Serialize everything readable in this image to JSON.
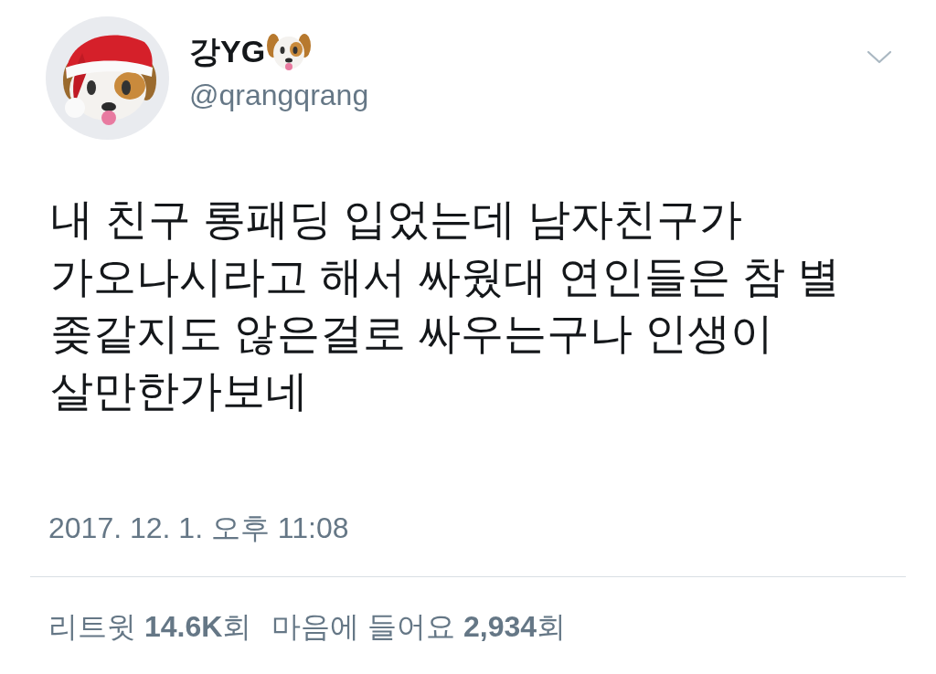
{
  "author": {
    "display_name": "강YG",
    "handle": "@qrangqrang"
  },
  "tweet": {
    "text": "내 친구 롱패딩 입었는데 남자친구가 가오나시라고 해서 싸웠대 연인들은 참 별 좆같지도 않은걸로 싸우는구나 인생이 살만한가보네",
    "timestamp": "2017. 12. 1. 오후 11:08"
  },
  "stats": [
    "리트윗 **14.6K**회",
    "마음에 들어요 **2,934**회"
  ]
}
